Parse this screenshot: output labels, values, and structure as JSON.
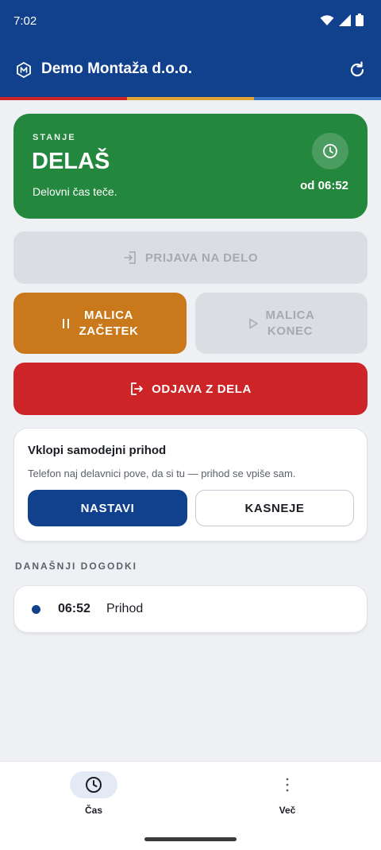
{
  "statusbar": {
    "time": "7:02",
    "icons": [
      "wifi-icon",
      "signal-icon",
      "battery-icon"
    ]
  },
  "appbar": {
    "title": "Demo Montaža d.o.o.",
    "logo_letter": "M"
  },
  "colors": {
    "brand_blue": "#11408c",
    "status_green": "#23873d",
    "lunch_orange": "#c9791b",
    "checkout_red": "#cc2427",
    "accent_strip": [
      "#cc2427",
      "#11408c",
      "#e2a236",
      "#11408c",
      "#3a74c4",
      "#11408c"
    ]
  },
  "status_card": {
    "label": "STANJE",
    "value": "DELAŠ",
    "description": "Delovni čas teče.",
    "since": "od 06:52"
  },
  "actions": {
    "check_in": "PRIJAVA NA DELO",
    "lunch_start_line1": "MALICA",
    "lunch_start_line2": "ZAČETEK",
    "lunch_end_line1": "MALICA",
    "lunch_end_line2": "KONEC",
    "check_out": "ODJAVA Z DELA"
  },
  "auto_checkin": {
    "title": "Vklopi samodejni prihod",
    "description": "Telefon naj delavnici pove, da si tu — prihod se vpiše sam.",
    "setup_label": "NASTAVI",
    "later_label": "KASNEJE"
  },
  "events": {
    "section_title": "DANAŠNJI DOGODKI",
    "items": [
      {
        "time": "06:52",
        "label": "Prihod"
      }
    ]
  },
  "bottomnav": {
    "items": [
      {
        "label": "Čas",
        "icon": "clock-icon",
        "active": true
      },
      {
        "label": "Več",
        "icon": "more-vertical-icon",
        "active": false
      }
    ]
  }
}
